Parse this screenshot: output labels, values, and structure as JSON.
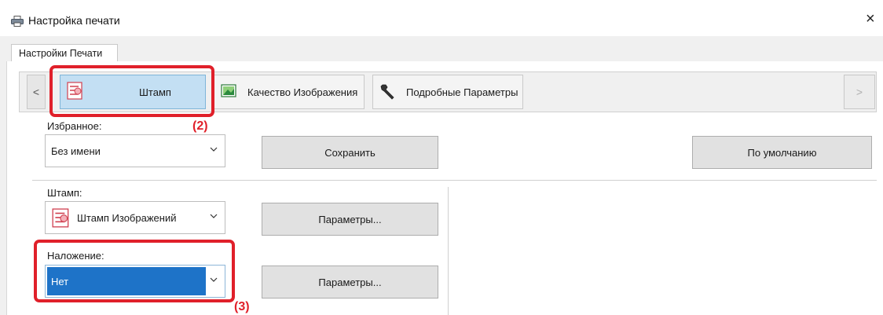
{
  "window": {
    "title": "Настройка печати",
    "title_icon": "printer-icon",
    "close_glyph": "×"
  },
  "tabs": [
    {
      "label": "Настройки Печати",
      "active": true
    }
  ],
  "ribbon": {
    "prev_glyph": "<",
    "next_glyph": ">",
    "items": [
      {
        "label": "Штамп",
        "icon": "stamp-icon",
        "selected": true
      },
      {
        "label": "Качество Изображения",
        "icon": "image-quality-icon",
        "selected": false
      },
      {
        "label": "Подробные Параметры",
        "icon": "wrench-icon",
        "selected": false
      }
    ]
  },
  "favorites": {
    "label": "Избранное:",
    "value": "Без имени",
    "save_label": "Сохранить",
    "default_label": "По умолчанию"
  },
  "stamp": {
    "label": "Штамп:",
    "value": "Штамп Изображений",
    "params_label": "Параметры..."
  },
  "overlay": {
    "label": "Наложение:",
    "value": "Нет",
    "params_label": "Параметры..."
  },
  "callouts": {
    "step2": "(2)",
    "step3": "(3)"
  },
  "colors": {
    "highlight_red": "#e0202a",
    "selected_tab_bg": "#c3dff3",
    "selection_blue": "#1e73c8"
  }
}
